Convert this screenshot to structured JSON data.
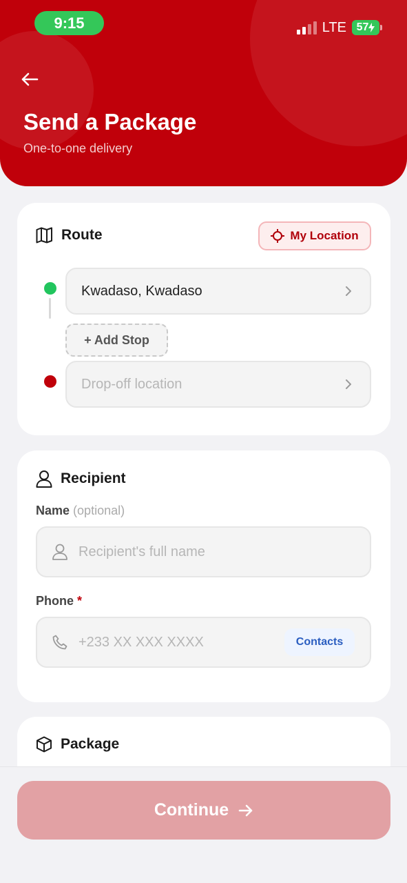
{
  "status_bar": {
    "time": "9:15",
    "network": "LTE",
    "battery": "57"
  },
  "header": {
    "title": "Send a Package",
    "subtitle": "One-to-one delivery"
  },
  "route": {
    "title": "Route",
    "my_location_label": "My Location",
    "pickup_value": "Kwadaso, Kwadaso",
    "add_stop_label": "+ Add Stop",
    "dropoff_placeholder": "Drop-off location"
  },
  "recipient": {
    "title": "Recipient",
    "name_label": "Name",
    "name_optional": "(optional)",
    "name_placeholder": "Recipient's full name",
    "phone_label": "Phone",
    "phone_required": "*",
    "phone_placeholder": "+233 XX XXX XXXX",
    "contacts_label": "Contacts"
  },
  "package": {
    "title": "Package"
  },
  "footer": {
    "continue_label": "Continue"
  },
  "colors": {
    "brand": "#c0000a",
    "pickup_dot": "#22c55e",
    "dropoff_dot": "#c0000a"
  }
}
